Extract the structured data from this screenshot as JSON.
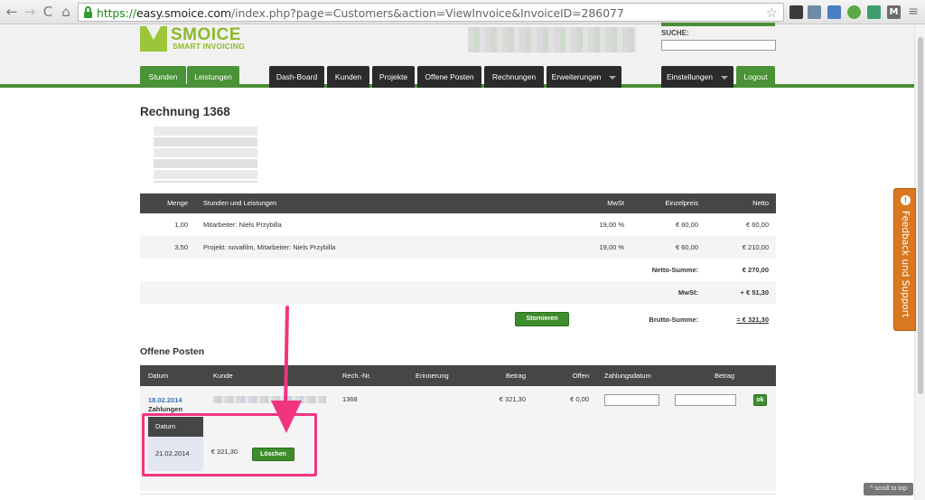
{
  "browser": {
    "back": "←",
    "forward": "→",
    "reload": "C",
    "home": "⌂",
    "url_scheme": "https://",
    "url_host": "easy.smoice.com",
    "url_path": "/index.php?page=Customers&action=ViewInvoice&InvoiceID=286077",
    "star": "☆",
    "ext_labels": [
      "",
      "",
      "",
      "",
      "",
      "M"
    ]
  },
  "header": {
    "logo_name": "SMOICE",
    "logo_tagline": "SMART INVOICING",
    "search_label": "SUCHE:",
    "search_value": ""
  },
  "nav": {
    "left": [
      "Stunden",
      "Leistungen"
    ],
    "middle": [
      "Dash-Board",
      "Kunden",
      "Projekte",
      "Offene Posten",
      "Rechnungen",
      "Erweiterungen"
    ],
    "right": [
      "Einstellungen",
      "Logout"
    ]
  },
  "invoice": {
    "title": "Rechnung 1368",
    "columns": {
      "menge": "Menge",
      "beschreibung": "Stunden und Leistungen",
      "mwst": "MwSt",
      "einzelpreis": "Einzelpreis",
      "netto": "Netto"
    },
    "rows": [
      {
        "menge": "1,00",
        "beschreibung": "Mitarbeiter: Niels Przybilla",
        "mwst": "19,00 %",
        "einzelpreis": "€ 60,00",
        "netto": "€ 60,00"
      },
      {
        "menge": "3,50",
        "beschreibung": "Projekt: novafilm, Mitarbeiter: Niels Przybilla",
        "mwst": "19,00 %",
        "einzelpreis": "€ 60,00",
        "netto": "€ 210,00"
      }
    ],
    "netto_summe_label": "Netto-Summe:",
    "netto_summe_value": "€ 270,00",
    "mwst_label": "MwSt:",
    "mwst_value": "+ € 51,30",
    "brutto_label": "Brutto-Summe:",
    "brutto_value": "= € 321,30",
    "stornieren_label": "Stornieren"
  },
  "offene": {
    "title": "Offene Posten",
    "columns": {
      "datum": "Datum",
      "kunde": "Kunde",
      "rech_nr": "Rech.-Nr.",
      "erinnerung": "Erinnerung",
      "betrag": "Betrag",
      "offen": "Offen",
      "zahlungsdatum": "Zahlungsdatum",
      "betrag2": "Betrag"
    },
    "row": {
      "datum": "18.02.2014",
      "zahlungen": "Zahlungen",
      "rech_nr": "1368",
      "betrag": "€ 321,30",
      "offen": "€ 0,00",
      "zahlungsdatum": "",
      "betrag2": "",
      "ok_label": "ok"
    },
    "payment": {
      "datum_header": "Datum",
      "datum": "21.02.2014",
      "betrag": "€ 321,30",
      "loeschen_label": "Löschen"
    }
  },
  "feedback": {
    "label": "Feedback und Support",
    "icon": "megaphone-icon"
  },
  "scroll_to_top": "^ scroll to top",
  "colors": {
    "brand_green": "#4a9236",
    "accent_pink": "#f2347f",
    "feedback_orange": "#d9781f",
    "nav_dark": "#2b2b2b"
  }
}
